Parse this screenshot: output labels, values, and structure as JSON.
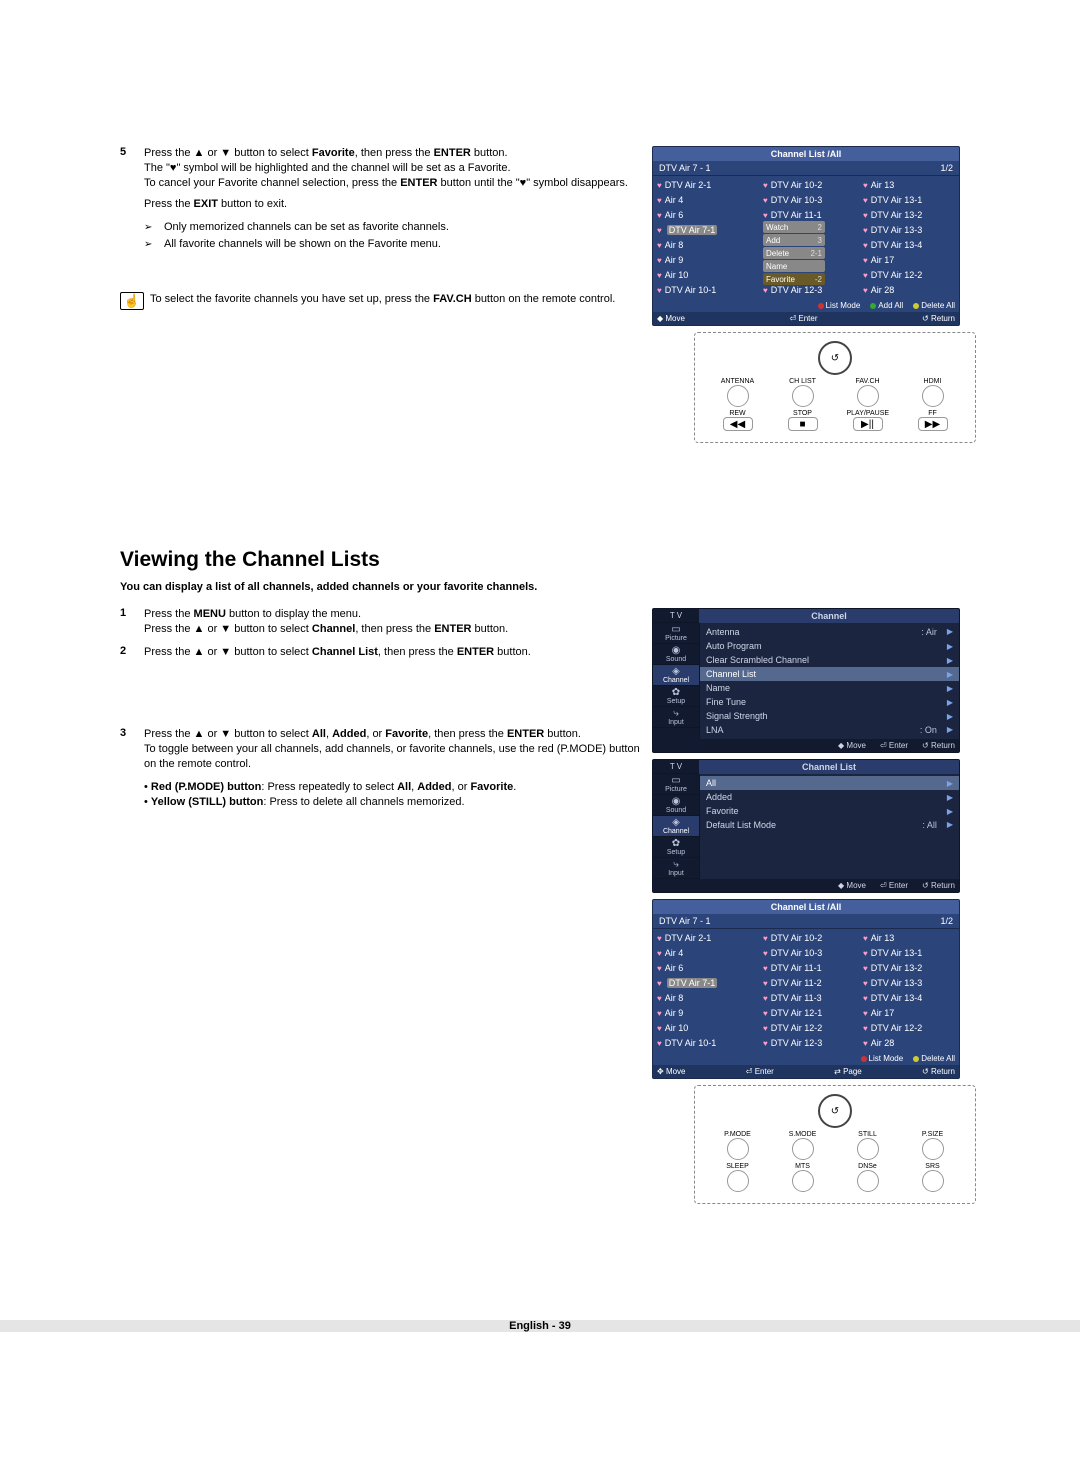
{
  "step5": {
    "num": "5",
    "line1a": "Press the ▲ or ▼ button to select ",
    "line1b": "Favorite",
    "line1c": ", then press the ",
    "line1d": "ENTER",
    "line1e": " button.",
    "line2": "The \"♥\" symbol will be highlighted and the channel will be set as a Favorite.",
    "line3a": "To cancel your Favorite channel selection, press the ",
    "line3b": "ENTER",
    "line3c": " button until the \"♥\" symbol disappears.",
    "line4a": "Press the ",
    "line4b": "EXIT",
    "line4c": " button to exit.",
    "arrow1": "Only memorized channels can be set as favorite channels.",
    "arrow2": "All favorite channels will be shown on the Favorite menu."
  },
  "hand_note": {
    "a": "To select the favorite channels you have set up, press the ",
    "b": "FAV.CH",
    "c": " button on the remote control."
  },
  "section2": {
    "title": "Viewing the Channel Lists",
    "sub": "You can display a list of all channels, added channels or your favorite channels."
  },
  "s2step1": {
    "num": "1",
    "a": "Press the ",
    "b": "MENU",
    "c": " button to display the menu.",
    "d": "Press the ▲ or ▼ button to select ",
    "e": "Channel",
    "f": ", then press the ",
    "g": "ENTER",
    "h": " button."
  },
  "s2step2": {
    "num": "2",
    "a": "Press the ▲ or ▼ button to select ",
    "b": "Channel List",
    "c": ", then press the ",
    "d": "ENTER",
    "e": " button."
  },
  "s2step3": {
    "num": "3",
    "a": "Press the ▲ or ▼ button to select ",
    "b": "All",
    "c": ", ",
    "d": "Added",
    "e": ", or ",
    "f": "Favorite",
    "g": ", then press the ",
    "h": "ENTER",
    "i": " button.",
    "j": "To toggle between your all channels, add channels, or favorite channels, use the red (P.MODE) button on the remote control.",
    "k1a": "Red (P.MODE) button",
    "k1b": ": Press repeatedly to select ",
    "k1c": "All",
    "k1d": ", ",
    "k1e": "Added",
    "k1f": ", or ",
    "k1g": "Favorite",
    "k1h": ".",
    "k2a": "Yellow (STILL) button",
    "k2b": ": Press to delete all channels memorized."
  },
  "osd1": {
    "title": "Channel List /All",
    "sub_left": "DTV Air 7 - 1",
    "sub_right": "1/2",
    "cols": [
      [
        "DTV Air 2-1",
        "Air 4",
        "Air 6",
        "DTV Air 7-1",
        "Air 8",
        "Air 9",
        "Air 10",
        "DTV Air 10-1"
      ],
      [
        "DTV Air 10-2",
        "DTV Air 10-3",
        "DTV Air 11-1",
        "",
        "",
        "",
        "",
        "DTV Air 12-3"
      ],
      [
        "Air 13",
        "DTV Air 13-1",
        "DTV Air 13-2",
        "DTV Air 13-3",
        "DTV Air 13-4",
        "Air 17",
        "DTV Air 12-2",
        "Air 28"
      ]
    ],
    "ctx": [
      "Watch",
      "Add",
      "Delete",
      "Name",
      "Favorite"
    ],
    "ctx_nums": [
      "2",
      "3",
      "2-1",
      "",
      "-2"
    ],
    "foot_lm": "List Mode",
    "foot_add": "Add All",
    "foot_del": "Delete All",
    "foot_move": "Move",
    "foot_enter": "Enter",
    "foot_return": "Return"
  },
  "remote1": {
    "row1": [
      "ANTENNA",
      "CH LIST",
      "FAV.CH",
      "HDMI"
    ],
    "row2": [
      "REW",
      "STOP",
      "PLAY/PAUSE",
      "FF"
    ],
    "row2_sym": [
      "◀◀",
      "■",
      "▶||",
      "▶▶"
    ]
  },
  "menu1": {
    "tvlabel": "T V",
    "title": "Channel",
    "side": [
      "Picture",
      "Sound",
      "Channel",
      "Setup",
      "Input"
    ],
    "items": [
      {
        "l": "Antenna",
        "r": ": Air",
        "arr": "▶"
      },
      {
        "l": "Auto Program",
        "r": "",
        "arr": "▶"
      },
      {
        "l": "Clear Scrambled Channel",
        "r": "",
        "arr": "▶"
      },
      {
        "l": "Channel List",
        "r": "",
        "arr": "▶",
        "hl": true
      },
      {
        "l": "Name",
        "r": "",
        "arr": "▶"
      },
      {
        "l": "Fine Tune",
        "r": "",
        "arr": "▶"
      },
      {
        "l": "Signal Strength",
        "r": "",
        "arr": "▶"
      },
      {
        "l": "LNA",
        "r": ": On",
        "arr": "▶"
      }
    ],
    "foot": {
      "move": "Move",
      "enter": "Enter",
      "return": "Return"
    }
  },
  "menu2": {
    "tvlabel": "T V",
    "title": "Channel List",
    "side": [
      "Picture",
      "Sound",
      "Channel",
      "Setup",
      "Input"
    ],
    "items": [
      {
        "l": "All",
        "r": "",
        "arr": "▶",
        "hl": true
      },
      {
        "l": "Added",
        "r": "",
        "arr": "▶"
      },
      {
        "l": "Favorite",
        "r": "",
        "arr": "▶"
      },
      {
        "l": "Default List Mode",
        "r": ": All",
        "arr": "▶"
      }
    ],
    "foot": {
      "move": "Move",
      "enter": "Enter",
      "return": "Return"
    }
  },
  "osd2": {
    "title": "Channel List /All",
    "sub_left": "DTV Air 7 - 1",
    "sub_right": "1/2",
    "cols": [
      [
        "DTV Air 2-1",
        "Air 4",
        "Air 6",
        "DTV Air 7-1",
        "Air 8",
        "Air 9",
        "Air 10",
        "DTV Air 10-1"
      ],
      [
        "DTV Air 10-2",
        "DTV Air 10-3",
        "DTV Air 11-1",
        "DTV Air 11-2",
        "DTV Air 11-3",
        "DTV Air 12-1",
        "DTV Air 12-2",
        "DTV Air 12-3"
      ],
      [
        "Air 13",
        "DTV Air 13-1",
        "DTV Air 13-2",
        "DTV Air 13-3",
        "DTV Air 13-4",
        "Air 17",
        "DTV Air 12-2",
        "Air 28"
      ]
    ],
    "foot_lm": "List Mode",
    "foot_del": "Delete All",
    "foot_move": "Move",
    "foot_enter": "Enter",
    "foot_page": "Page",
    "foot_return": "Return"
  },
  "remote2": {
    "row1": [
      "P.MODE",
      "S.MODE",
      "STILL",
      "P.SIZE"
    ],
    "row2": [
      "SLEEP",
      "MTS",
      "DNSe",
      "SRS"
    ]
  },
  "footer": "English - 39"
}
